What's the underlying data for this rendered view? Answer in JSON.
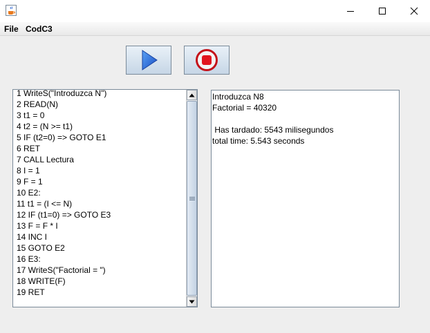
{
  "window": {
    "icon": "java-cup-icon",
    "controls": [
      "minimize-icon",
      "maximize-icon",
      "close-icon"
    ]
  },
  "menu": {
    "file_label": "File",
    "codc3_label": "CodC3"
  },
  "toolbar": {
    "run_icon": "play-icon",
    "stop_icon": "stop-icon",
    "colors": {
      "play": "#1f5fd6",
      "stop": "#e2141e"
    }
  },
  "code": {
    "lines": [
      "1 WriteS(\"Introduzca N\")",
      "2 READ(N)",
      "3 t1 = 0",
      "4 t2 = (N >= t1)",
      "5 IF (t2=0) => GOTO E1",
      "6 RET",
      "7 CALL Lectura",
      "8 I = 1",
      "9 F = 1",
      "10 E2:",
      "11 t1 = (I <= N)",
      "12 IF (t1=0) => GOTO E3",
      "13 F = F * I",
      "14 INC I",
      "15 GOTO E2",
      "16 E3:",
      "17 WriteS(\"Factorial = \")",
      "18 WRITE(F)",
      "19 RET"
    ]
  },
  "output": {
    "lines": [
      "Introduzca N8",
      "Factorial = 40320",
      "",
      " Has tardado: 5543 milisegundos",
      "total time: 5.543 seconds"
    ]
  }
}
